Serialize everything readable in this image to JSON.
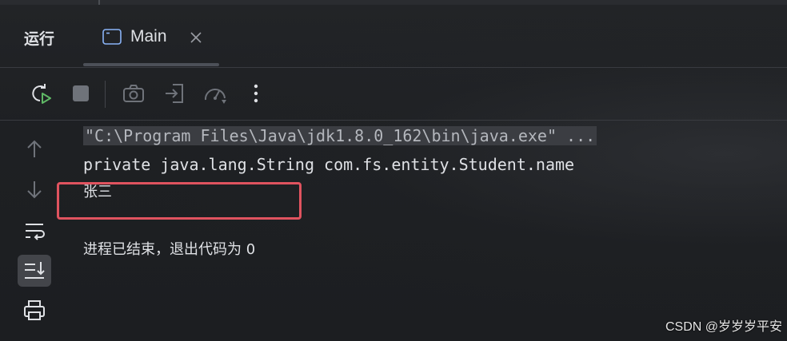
{
  "window": {
    "panel_title": "运行",
    "tabs": [
      {
        "label": "Main",
        "icon": "console-window-icon",
        "close_icon": "close-icon"
      }
    ]
  },
  "toolbar": {
    "buttons": [
      {
        "name": "rerun-button",
        "icon": "rerun-icon"
      },
      {
        "name": "stop-button",
        "icon": "stop-icon"
      },
      {
        "name": "screenshot-button",
        "icon": "camera-icon"
      },
      {
        "name": "restore-layout-button",
        "icon": "login-arrow-icon"
      },
      {
        "name": "profiler-button",
        "icon": "speedometer-icon"
      },
      {
        "name": "more-options-button",
        "icon": "vertical-ellipsis-icon"
      }
    ]
  },
  "sidebar": {
    "buttons": [
      {
        "name": "up-stack-button",
        "icon": "arrow-up-icon"
      },
      {
        "name": "down-stack-button",
        "icon": "arrow-down-icon"
      },
      {
        "name": "soft-wrap-button",
        "icon": "soft-wrap-icon"
      },
      {
        "name": "scroll-to-end-button",
        "icon": "scroll-to-end-icon",
        "active": true
      },
      {
        "name": "print-button",
        "icon": "printer-icon"
      }
    ]
  },
  "console": {
    "lines": [
      "\"C:\\Program Files\\Java\\jdk1.8.0_162\\bin\\java.exe\" ...",
      "private java.lang.String com.fs.entity.Student.name",
      "张三",
      "",
      "进程已结束，退出代码为 0"
    ]
  },
  "annotation": {
    "highlight_color": "#e0535f"
  },
  "watermark": "CSDN @岁岁岁平安",
  "colors": {
    "background": "#1e2023",
    "text": "#dfe1e5",
    "accent": "#3574f0"
  }
}
